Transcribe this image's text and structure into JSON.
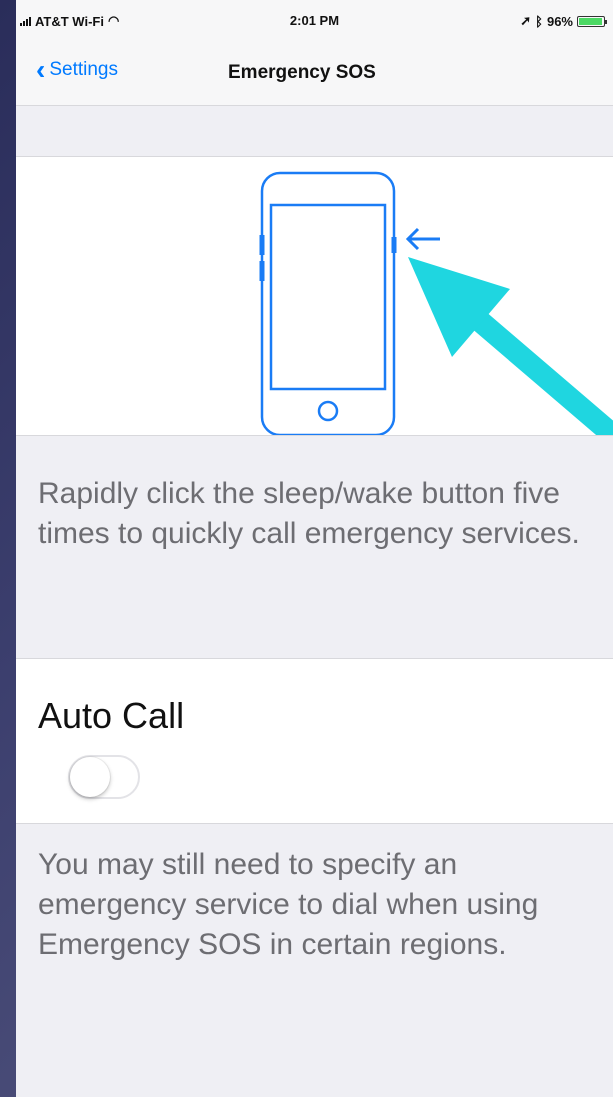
{
  "status_bar": {
    "carrier": "AT&T Wi-Fi",
    "wifi_icon": "wifi-icon",
    "time": "2:01 PM",
    "location_icon": "location-arrow-icon",
    "bluetooth_icon": "bluetooth-icon",
    "battery_percent": "96%",
    "battery_level": 0.96
  },
  "nav": {
    "back_label": "Settings",
    "title": "Emergency SOS"
  },
  "illustration": {
    "phone_icon": "iphone-outline-icon",
    "arrow_icon": "arrow-left-icon",
    "annotation_icon": "cyan-pointer-arrow-icon",
    "colors": {
      "phone": "#1a7cf5",
      "annotation": "#1fd6e0"
    }
  },
  "instructions": "Rapidly click the sleep/wake button five times to quickly call emergency services.",
  "auto_call": {
    "label": "Auto Call",
    "enabled": false
  },
  "footer_note": "You may still need to specify an emergency service to dial when using Emergency SOS in certain regions.",
  "colors": {
    "accent": "#007aff",
    "background": "#efeff4",
    "secondary_text": "#6d6d72"
  }
}
